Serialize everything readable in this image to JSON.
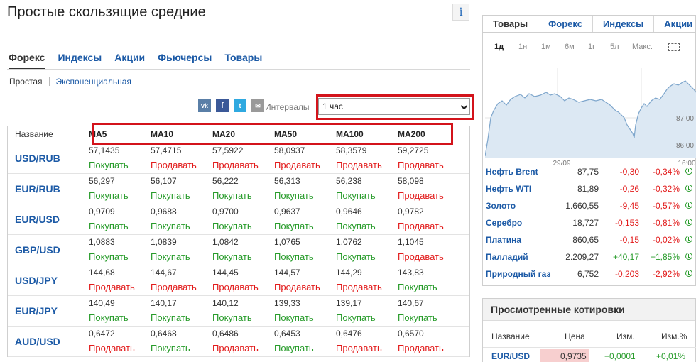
{
  "title": "Простые скользящие средние",
  "info_glyph": "i",
  "tabs": [
    "Форекс",
    "Индексы",
    "Акции",
    "Фьючерсы",
    "Товары"
  ],
  "subtabs": [
    "Простая",
    "Экспоненциальная"
  ],
  "share": {
    "vk": "vk",
    "fb": "f",
    "tw": "t",
    "mail": "✉"
  },
  "interval_label": "Интервалы",
  "interval_value": "1 час",
  "table": {
    "name_header": "Название",
    "ma_headers": [
      "MA5",
      "MA10",
      "MA20",
      "MA50",
      "MA100",
      "MA200"
    ],
    "rows": [
      {
        "name": "USD/RUB",
        "cells": [
          [
            "57,1435",
            "Покупать"
          ],
          [
            "57,4715",
            "Продавать"
          ],
          [
            "57,5922",
            "Продавать"
          ],
          [
            "58,0937",
            "Продавать"
          ],
          [
            "58,3579",
            "Продавать"
          ],
          [
            "59,2725",
            "Продавать"
          ]
        ]
      },
      {
        "name": "EUR/RUB",
        "cells": [
          [
            "56,297",
            "Покупать"
          ],
          [
            "56,107",
            "Покупать"
          ],
          [
            "56,222",
            "Покупать"
          ],
          [
            "56,313",
            "Покупать"
          ],
          [
            "56,238",
            "Покупать"
          ],
          [
            "58,098",
            "Продавать"
          ]
        ]
      },
      {
        "name": "EUR/USD",
        "cells": [
          [
            "0,9709",
            "Покупать"
          ],
          [
            "0,9688",
            "Покупать"
          ],
          [
            "0,9700",
            "Покупать"
          ],
          [
            "0,9637",
            "Покупать"
          ],
          [
            "0,9646",
            "Покупать"
          ],
          [
            "0,9782",
            "Продавать"
          ]
        ]
      },
      {
        "name": "GBP/USD",
        "cells": [
          [
            "1,0883",
            "Покупать"
          ],
          [
            "1,0839",
            "Покупать"
          ],
          [
            "1,0842",
            "Покупать"
          ],
          [
            "1,0765",
            "Покупать"
          ],
          [
            "1,0762",
            "Покупать"
          ],
          [
            "1,1045",
            "Продавать"
          ]
        ]
      },
      {
        "name": "USD/JPY",
        "cells": [
          [
            "144,68",
            "Продавать"
          ],
          [
            "144,67",
            "Продавать"
          ],
          [
            "144,45",
            "Продавать"
          ],
          [
            "144,57",
            "Продавать"
          ],
          [
            "144,29",
            "Продавать"
          ],
          [
            "143,83",
            "Покупать"
          ]
        ]
      },
      {
        "name": "EUR/JPY",
        "cells": [
          [
            "140,49",
            "Покупать"
          ],
          [
            "140,17",
            "Покупать"
          ],
          [
            "140,12",
            "Покупать"
          ],
          [
            "139,33",
            "Покупать"
          ],
          [
            "139,17",
            "Покупать"
          ],
          [
            "140,67",
            "Покупать"
          ]
        ]
      },
      {
        "name": "AUD/USD",
        "cells": [
          [
            "0,6472",
            "Продавать"
          ],
          [
            "0,6468",
            "Покупать"
          ],
          [
            "0,6486",
            "Продавать"
          ],
          [
            "0,6453",
            "Покупать"
          ],
          [
            "0,6476",
            "Продавать"
          ],
          [
            "0,6570",
            "Продавать"
          ]
        ]
      }
    ]
  },
  "right_panel": {
    "tabs": [
      "Товары",
      "Форекс",
      "Индексы",
      "Акции"
    ],
    "periods": [
      "1д",
      "1н",
      "1м",
      "6м",
      "1г",
      "5л",
      "Макс."
    ],
    "chart": {
      "y_ticks": [
        "87,00",
        "86,00"
      ],
      "x_ticks": [
        "29/09",
        "16:00"
      ]
    },
    "quotes": [
      {
        "name": "Нефть Brent",
        "last": "87,75",
        "chg": "-0,30",
        "pct": "-0,34%"
      },
      {
        "name": "Нефть WTI",
        "last": "81,89",
        "chg": "-0,26",
        "pct": "-0,32%"
      },
      {
        "name": "Золото",
        "last": "1.660,55",
        "chg": "-9,45",
        "pct": "-0,57%"
      },
      {
        "name": "Серебро",
        "last": "18,727",
        "chg": "-0,153",
        "pct": "-0,81%"
      },
      {
        "name": "Платина",
        "last": "860,65",
        "chg": "-0,15",
        "pct": "-0,02%"
      },
      {
        "name": "Палладий",
        "last": "2.209,27",
        "chg": "+40,17",
        "pct": "+1,85%"
      },
      {
        "name": "Природный газ",
        "last": "6,752",
        "chg": "-0,203",
        "pct": "-2,92%"
      }
    ]
  },
  "viewed": {
    "title": "Просмотренные котировки",
    "headers": {
      "name": "Название",
      "price": "Цена",
      "chg": "Изм.",
      "pct": "Изм.%"
    },
    "row": {
      "name": "EUR/USD",
      "price": "0,9735",
      "chg": "+0,0001",
      "pct": "+0,01%"
    }
  },
  "colors": {
    "link": "#1c5aa6",
    "buy": "#279b2a",
    "sell": "#e21b1b",
    "highlight": "#d3131b",
    "chart_fill": "#dce8f3",
    "chart_line": "#7ea6cc"
  }
}
